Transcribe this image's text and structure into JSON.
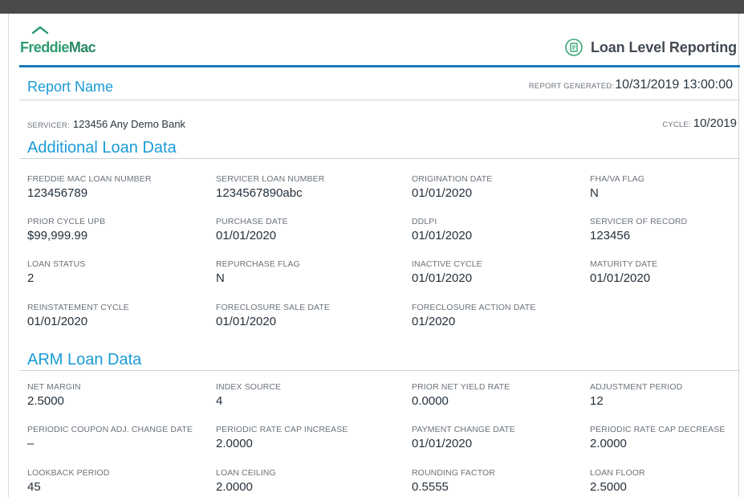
{
  "header": {
    "logo_part1": "Freddie",
    "logo_part2": "Mac",
    "logo_name": "Freddie Mac",
    "app_title": "Loan Level Reporting",
    "app_icon": "loan-document-icon"
  },
  "report": {
    "name": "Report Name",
    "generated_label": "REPORT GENERATED:",
    "generated_value": "10/31/2019 13:00:00",
    "servicer_label": "SERVICER:",
    "servicer_value": "123456 Any Demo Bank",
    "cycle_label": "CYCLE:",
    "cycle_value": "10/2019"
  },
  "sections": {
    "additional": {
      "title": "Additional Loan Data",
      "fields": [
        {
          "label": "FREDDIE MAC LOAN NUMBER",
          "value": "123456789"
        },
        {
          "label": "SERVICER LOAN NUMBER",
          "value": "1234567890abc"
        },
        {
          "label": "ORIGINATION DATE",
          "value": "01/01/2020"
        },
        {
          "label": "FHA/VA FLAG",
          "value": "N"
        },
        {
          "label": "PRIOR CYCLE UPB",
          "value": "$99,999.99"
        },
        {
          "label": "PURCHASE DATE",
          "value": "01/01/2020"
        },
        {
          "label": "DDLPI",
          "value": "01/01/2020"
        },
        {
          "label": "SERVICER OF RECORD",
          "value": "123456"
        },
        {
          "label": "LOAN STATUS",
          "value": "2"
        },
        {
          "label": "REPURCHASE FLAG",
          "value": "N"
        },
        {
          "label": "INACTIVE CYCLE",
          "value": "01/01/2020"
        },
        {
          "label": "MATURITY DATE",
          "value": "01/01/2020"
        },
        {
          "label": "REINSTATEMENT CYCLE",
          "value": "01/01/2020"
        },
        {
          "label": "FORECLOSURE SALE DATE",
          "value": "01/01/2020"
        },
        {
          "label": "FORECLOSURE ACTION DATE",
          "value": "01/2020"
        }
      ]
    },
    "arm": {
      "title": "ARM Loan Data",
      "fields": [
        {
          "label": "NET MARGIN",
          "value": "2.5000"
        },
        {
          "label": "INDEX SOURCE",
          "value": "4"
        },
        {
          "label": "PRIOR NET YIELD RATE",
          "value": "0.0000"
        },
        {
          "label": "ADJUSTMENT PERIOD",
          "value": "12"
        },
        {
          "label": "PERIODIC COUPON ADJ. CHANGE DATE",
          "value": "–"
        },
        {
          "label": "PERIODIC RATE CAP INCREASE",
          "value": "2.0000"
        },
        {
          "label": "PAYMENT CHANGE DATE",
          "value": "01/01/2020"
        },
        {
          "label": "PERIODIC RATE CAP DECREASE",
          "value": "2.0000"
        },
        {
          "label": "LOOKBACK PERIOD",
          "value": "45"
        },
        {
          "label": "LOAN CEILING",
          "value": "2.0000"
        },
        {
          "label": "ROUNDING FACTOR",
          "value": "0.5555"
        },
        {
          "label": "LOAN FLOOR",
          "value": "2.5000"
        }
      ]
    }
  },
  "colors": {
    "brand_green": "#2f9c70",
    "accent_blue": "#1a9bd8",
    "rule_blue": "#1b79b8"
  }
}
